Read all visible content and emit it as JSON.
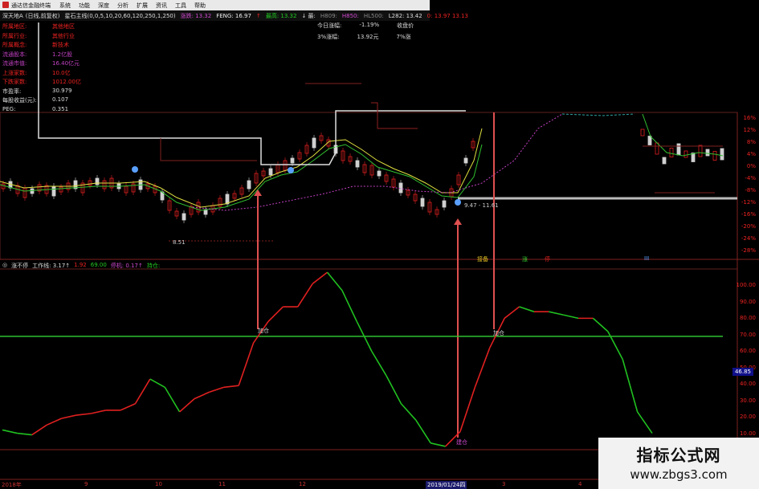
{
  "menubar": {
    "title": "通达信金融终端",
    "items": [
      "系统",
      "功能",
      "深度",
      "分析",
      "扩展",
      "资讯",
      "工具",
      "帮助"
    ]
  },
  "titlebar": {
    "stock": "深天地A",
    "period": "(日线,前复权)",
    "indicator": "星石主线(0,0,5,10,20,60,120,250,1,250)",
    "field1": "涨跌: 13.32",
    "feng": "FENG: 16.97",
    "field3": "↑",
    "field4": "最高: 13.32",
    "field5": "↓ 最:",
    "h809": "H809: ",
    "h850": "H850: ",
    "hl500": "HL500: ",
    "l282": "L282: 13.42",
    "extra": "0: 13.97  13.13"
  },
  "info_panel": [
    {
      "k": "所属地区:",
      "v": "其他地区"
    },
    {
      "k": "所属行业:",
      "v": "其他行业"
    },
    {
      "k": "所属概念:",
      "v": "新技术"
    },
    {
      "k": "流通股本:",
      "v": "1.2亿股"
    },
    {
      "k": "流通市值:",
      "v": "16.40亿元"
    },
    {
      "k": "上涨家数:",
      "v": "10.0亿"
    },
    {
      "k": "下跌家数:",
      "v": "1012.00亿"
    },
    {
      "k": "市盈率:",
      "v": "30.979"
    },
    {
      "k": "每股收益(元):",
      "v": "0.107"
    },
    {
      "k": "PEG:",
      "v": "0.351"
    }
  ],
  "quote_panel": [
    {
      "k": "今日涨幅:",
      "v": "-1.19%",
      "k2": "收盘价"
    },
    {
      "k": "3%涨幅:",
      "v": "13.92元",
      "k2": "7%涨"
    }
  ],
  "price_axis": [
    "16%",
    "12%",
    "8%",
    "4%",
    "0%",
    "-4%",
    "-8%",
    "-12%",
    "-16%",
    "-20%",
    "-24%",
    "-28%"
  ],
  "price_annotation": "9.47 - 11.61",
  "low_annotation": "8.51",
  "indicator_title": {
    "name": "涨不停",
    "line": "工作线: 3.17↑",
    "v1": "1.92",
    "v2": "69.00",
    "v3": "停机: 0.17↑",
    "v4": "持仓:"
  },
  "signal_labels": {
    "lianban": "接备",
    "zhang": "涨",
    "ting": "停",
    "mark": "III"
  },
  "buy_labels": [
    "加仓",
    "建仓",
    "加仓"
  ],
  "indicator_axis": [
    "100.00",
    "90.00",
    "80.00",
    "70.00",
    "60.00",
    "50.00",
    "40.00",
    "30.00",
    "20.00",
    "10.00"
  ],
  "value_box": "46.85",
  "xaxis": [
    "2018年",
    "9",
    "10",
    "11",
    "12",
    "2019/01/24四",
    "3",
    "4"
  ],
  "watermark": {
    "line1": "指标公式网",
    "line2": "www.zbgs3.com"
  },
  "colors": {
    "up": "#e02020",
    "down": "#20c020",
    "accent": "#30d030",
    "axis": "#802020"
  },
  "chart_data": {
    "type": "line",
    "title": "涨不停",
    "ylim": [
      0,
      110
    ],
    "series": [
      {
        "name": "工作线",
        "values": [
          12,
          10,
          9,
          15,
          19,
          21,
          22,
          24,
          24,
          28,
          43,
          38,
          23,
          31,
          35,
          38,
          39,
          65,
          78,
          87,
          87,
          101,
          108,
          97,
          78,
          60,
          45,
          28,
          18,
          4,
          2,
          11,
          38,
          62,
          80,
          87,
          84,
          84,
          82,
          80,
          80,
          72,
          55,
          23,
          10
        ]
      }
    ],
    "reference_line": 69
  }
}
